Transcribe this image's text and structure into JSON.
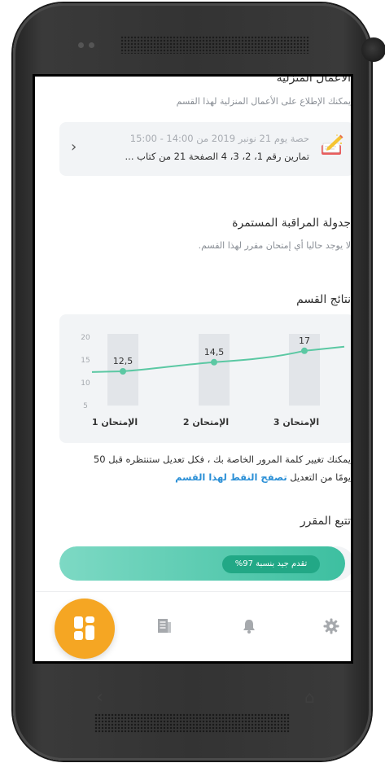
{
  "homework": {
    "title": "الأعمال المنزلية",
    "subtitle": "يمكنك الإطلاع على الأعمال المنزلية لهذا القسم",
    "session_line": "حصة يوم 21 نونبر 2019 من 14:00 - 15:00",
    "exercise_line": "تمارين رقم 1، 2، 3، 4 الصفحة 21 من كتاب ..."
  },
  "continuous_monitoring": {
    "title": "جدولة المراقبة المستمرة",
    "subtitle": "لا يوجد حاليا أي إمتحان مقرر لهذا القسم."
  },
  "class_results": {
    "title": "نتائج القسم"
  },
  "chart_data": {
    "type": "line",
    "categories": [
      "الإمتحان 1",
      "الإمتحان 2",
      "الإمتحان 3"
    ],
    "values": [
      12.5,
      14.5,
      17
    ],
    "value_labels": [
      "12,5",
      "14,5",
      "17"
    ],
    "y_ticks": [
      "20",
      "15",
      "10",
      "5"
    ],
    "ylim": [
      5,
      20
    ],
    "grid": false,
    "series_color": "#5bc8a3"
  },
  "info": {
    "line1": "يمكنك تغيير كلمة المرور الخاصة بك ، فكل تعديل ستنتظره قبل 50",
    "line2_prefix": "يومًا من التعديل",
    "line2_link": "تصفح النقط لهذا القسم"
  },
  "course_tracking": {
    "title": "تتبع المقرر",
    "progress_fraction": 0.97,
    "progress_label": "تقدم جيد بنسبة 97%"
  },
  "bottom_nav": {
    "items": [
      "home-icon",
      "document-icon",
      "bell-icon",
      "gear-icon"
    ],
    "accent": "#f5a623"
  },
  "device_nav": {
    "back": "‹",
    "home": "⌂"
  }
}
